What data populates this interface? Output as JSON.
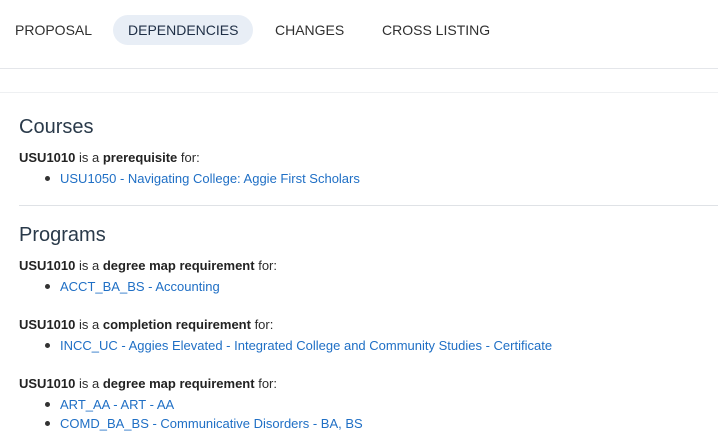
{
  "tabs": [
    {
      "label": "PROPOSAL",
      "active": false
    },
    {
      "label": "DEPENDENCIES",
      "active": true
    },
    {
      "label": "CHANGES",
      "active": false
    },
    {
      "label": "CROSS LISTING",
      "active": false
    }
  ],
  "courses": {
    "title": "Courses",
    "groups": [
      {
        "course": "USU1010",
        "is_a": "is a",
        "relation": "prerequisite",
        "for": "for:",
        "items": [
          "USU1050 - Navigating College: Aggie First Scholars"
        ]
      }
    ]
  },
  "programs": {
    "title": "Programs",
    "groups": [
      {
        "course": "USU1010",
        "is_a": "is a",
        "relation": "degree map requirement",
        "for": "for:",
        "items": [
          "ACCT_BA_BS - Accounting"
        ]
      },
      {
        "course": "USU1010",
        "is_a": "is a",
        "relation": "completion requirement",
        "for": "for:",
        "items": [
          "INCC_UC - Aggies Elevated - Integrated College and Community Studies - Certificate"
        ]
      },
      {
        "course": "USU1010",
        "is_a": "is a",
        "relation": "degree map requirement",
        "for": "for:",
        "items": [
          "ART_AA - ART - AA",
          "COMD_BA_BS - Communicative Disorders - BA, BS"
        ]
      }
    ]
  },
  "colors": {
    "link": "#1f6fc5",
    "active_tab_bg": "#e8eef6"
  }
}
